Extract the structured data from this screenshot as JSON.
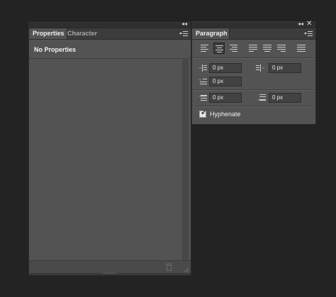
{
  "left_panel": {
    "tabs": [
      {
        "label": "Properties",
        "active": true
      },
      {
        "label": "Character",
        "active": false
      }
    ],
    "collapse_glyph": "◂◂",
    "heading": "No Properties",
    "footer_icons": [
      "trash-icon",
      "resize-grip-icon"
    ]
  },
  "right_panel": {
    "tabs": [
      {
        "label": "Paragraph",
        "active": true
      }
    ],
    "collapse_glyph": "◂◂",
    "close_glyph": "✕",
    "alignment_buttons": [
      {
        "name": "align-left",
        "selected": false
      },
      {
        "name": "align-center",
        "selected": true
      },
      {
        "name": "align-right",
        "selected": false
      },
      {
        "name": "justify-last-left",
        "selected": false
      },
      {
        "name": "justify-last-center",
        "selected": false
      },
      {
        "name": "justify-last-right",
        "selected": false
      },
      {
        "name": "justify-all",
        "selected": false
      }
    ],
    "fields": {
      "indent_left": "0 px",
      "indent_right": "0 px",
      "indent_first_line": "0 px",
      "space_before": "0 px",
      "space_after": "0 px"
    },
    "hyphenate": {
      "label": "Hyphenate",
      "checked": true
    }
  },
  "colors": {
    "background": "#232323",
    "panel": "#535353",
    "tab_bar": "#3c3c3c",
    "field": "#424242"
  }
}
